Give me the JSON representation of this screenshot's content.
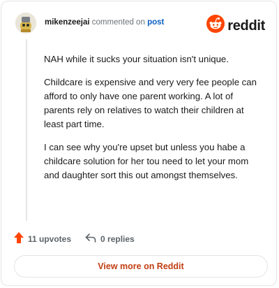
{
  "comment": {
    "username": "mikenzeejai",
    "commented_on_text": "commented on",
    "post_link": "post",
    "paragraphs": [
      "NAH while it sucks your situation isn't unique.",
      "Childcare is expensive and very very fee people can afford to only have one parent working. A lot of parents rely on relatives to watch their children at least part time.",
      "I can see why you're upset but unless you habe a childcare solution for her tou need to let your mom and daughter sort this out amongst themselves."
    ]
  },
  "brand": {
    "wordmark": "reddit",
    "color": "#ff4500"
  },
  "footer": {
    "upvotes": "11 upvotes",
    "replies": "0 replies"
  },
  "cta": {
    "label": "View more on Reddit"
  },
  "icons": [
    "avatar",
    "reddit-logo-icon",
    "upvote-arrow-icon",
    "reply-icon"
  ],
  "colors": {
    "accent": "#ff4500",
    "link": "#0a5ec2",
    "cta_text": "#c23e12"
  }
}
